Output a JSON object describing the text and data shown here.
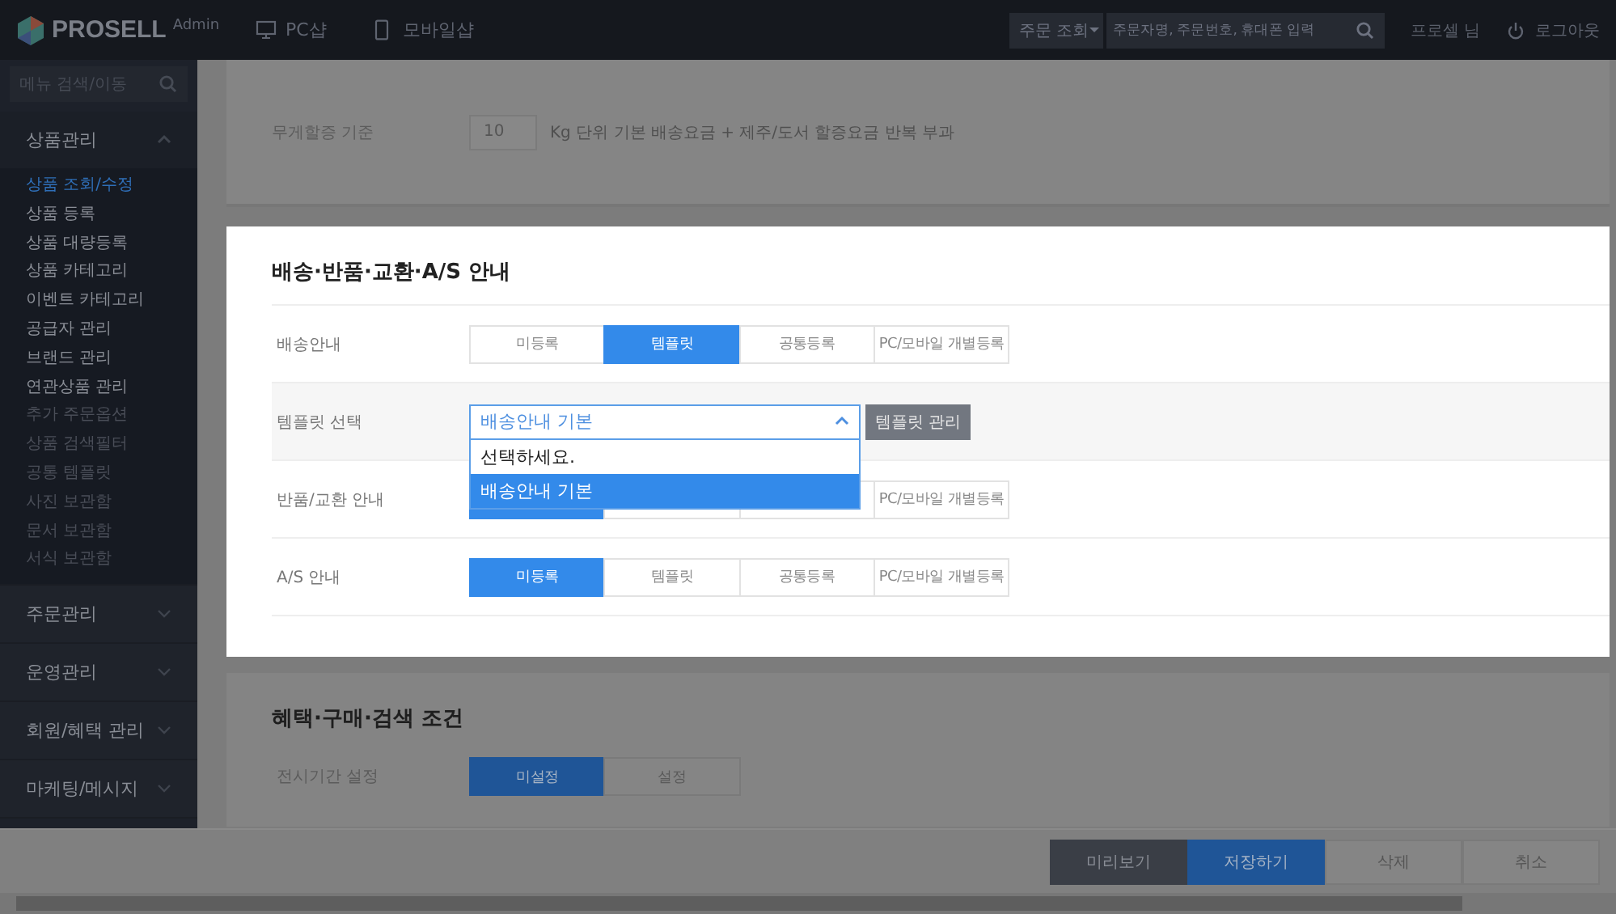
{
  "header": {
    "logo": {
      "name": "PROSELL",
      "suffix": "Admin"
    },
    "links": [
      {
        "label": "PC샵",
        "kind": "pc"
      },
      {
        "label": "모바일샵",
        "kind": "mobile"
      }
    ],
    "search_scope": "주문 조회",
    "search": {
      "placeholder": "주문자명, 주문번호, 휴대폰 입력"
    },
    "user": "프로셀 님",
    "logout": "로그아웃"
  },
  "sidebar": {
    "search": {
      "placeholder": "메뉴 검색/이동"
    },
    "sections": [
      {
        "label": "상품관리",
        "expanded": true,
        "children": [
          {
            "label": "상품 조회/수정",
            "selected": true,
            "disabled": false
          },
          {
            "label": "상품 등록",
            "selected": false,
            "disabled": false
          },
          {
            "label": "상품 대량등록",
            "selected": false,
            "disabled": false
          },
          {
            "label": "상품 카테고리",
            "selected": false,
            "disabled": false
          },
          {
            "label": "이벤트 카테고리",
            "selected": false,
            "disabled": false
          },
          {
            "label": "공급자 관리",
            "selected": false,
            "disabled": false
          },
          {
            "label": "브랜드 관리",
            "selected": false,
            "disabled": false
          },
          {
            "label": "연관상품 관리",
            "selected": false,
            "disabled": false
          },
          {
            "label": "추가 주문옵션",
            "selected": false,
            "disabled": true
          },
          {
            "label": "상품 검색필터",
            "selected": false,
            "disabled": true
          },
          {
            "label": "공통 템플릿",
            "selected": false,
            "disabled": true
          },
          {
            "label": "사진 보관함",
            "selected": false,
            "disabled": true
          },
          {
            "label": "문서 보관함",
            "selected": false,
            "disabled": true
          },
          {
            "label": "서식 보관함",
            "selected": false,
            "disabled": true
          }
        ]
      },
      {
        "label": "주문관리",
        "expanded": false
      },
      {
        "label": "운영관리",
        "expanded": false
      },
      {
        "label": "회원/혜택 관리",
        "expanded": false
      },
      {
        "label": "마케팅/메시지",
        "expanded": false
      }
    ]
  },
  "weight_card": {
    "label": "무게할증 기준",
    "value": "10",
    "note": "Kg 단위 기본 배송요금 + 제주/도서 할증요금 반복 부과"
  },
  "shipping_panel": {
    "title": "배송·반품·교환·A/S 안내",
    "rows": [
      {
        "kind": "segments",
        "label": "배송안내",
        "options": [
          {
            "label": "미등록",
            "selected": false
          },
          {
            "label": "템플릿",
            "selected": true
          },
          {
            "label": "공통등록",
            "selected": false
          },
          {
            "label": "PC/모바일 개별등록",
            "selected": false
          }
        ]
      },
      {
        "kind": "select",
        "label": "템플릿 선택",
        "value": "배송안내 기본",
        "expanded": true,
        "button": "템플릿 관리",
        "options": [
          {
            "label": "선택하세요.",
            "selected": false
          },
          {
            "label": "배송안내 기본",
            "selected": true
          }
        ]
      },
      {
        "kind": "segments",
        "label": "반품/교환 안내",
        "options": [
          {
            "selected": true
          },
          {
            "selected": false
          },
          {
            "selected": false
          },
          {
            "label": "PC/모바일 개별등록",
            "selected": false
          }
        ]
      },
      {
        "kind": "segments",
        "label": "A/S 안내",
        "options": [
          {
            "label": "미등록",
            "selected": true
          },
          {
            "label": "템플릿",
            "selected": false
          },
          {
            "label": "공통등록",
            "selected": false
          },
          {
            "label": "PC/모바일 개별등록",
            "selected": false
          }
        ]
      }
    ]
  },
  "conditions_card": {
    "title": "혜택·구매·검색 조건",
    "rows": [
      {
        "kind": "segments",
        "label": "전시기간 설정",
        "options": [
          {
            "label": "미설정",
            "selected": true
          },
          {
            "label": "설정",
            "selected": false
          }
        ]
      }
    ]
  },
  "actions": [
    {
      "label": "미리보기",
      "kind": "secondary"
    },
    {
      "label": "저장하기",
      "kind": "primary"
    },
    {
      "label": "삭제",
      "kind": "plain"
    },
    {
      "label": "취소",
      "kind": "plain"
    }
  ]
}
